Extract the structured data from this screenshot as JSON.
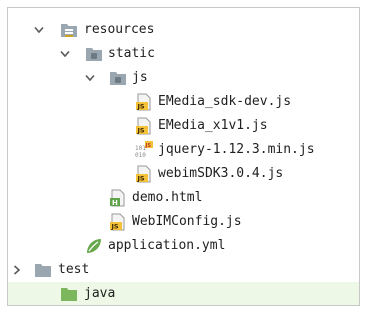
{
  "tree": {
    "resources": "resources",
    "static": "static",
    "js": "js",
    "files_js": [
      "EMedia_sdk-dev.js",
      "EMedia_x1v1.js",
      "jquery-1.12.3.min.js",
      "webimSDK3.0.4.js"
    ],
    "demo_html": "demo.html",
    "webim_config": "WebIMConfig.js",
    "application_yml": "application.yml",
    "test": "test",
    "java": "java"
  },
  "icons": {
    "js_badge": "JS",
    "html_badge": "H",
    "binary_badge": "101\n010"
  },
  "colors": {
    "folder_gray": "#9aa7b0",
    "folder_green": "#7cb75e",
    "js_yellow": "#f3c238",
    "html_green": "#5fa34a",
    "spring_green": "#6aa84f",
    "selected_bg": "#eef8e6"
  }
}
